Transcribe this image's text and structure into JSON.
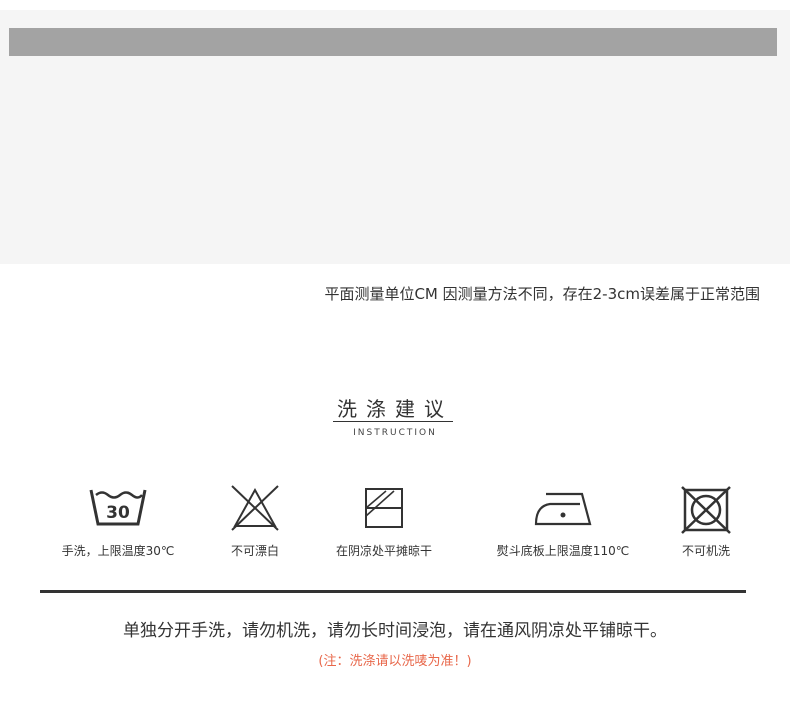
{
  "measurement": {
    "note": "平面测量单位CM  因测量方法不同，存在2-3cm误差属于正常范围"
  },
  "washing": {
    "title": "洗涤建议",
    "subtitle": "INSTRUCTION",
    "symbols": [
      {
        "icon": "hand-wash-30-icon",
        "label": "手洗，上限温度30℃",
        "temp": "30"
      },
      {
        "icon": "no-bleach-icon",
        "label": "不可漂白"
      },
      {
        "icon": "dry-flat-shade-icon",
        "label": "在阴凉处平摊晾干"
      },
      {
        "icon": "iron-low-temp-icon",
        "label": "熨斗底板上限温度110℃"
      },
      {
        "icon": "no-machine-wash-icon",
        "label": "不可机洗"
      }
    ],
    "instruction": "单独分开手洗，请勿机洗，请勿长时间浸泡，请在通风阴凉处平铺晾干。",
    "note": "(注：洗涤请以洗唛为准！)"
  },
  "colors": {
    "text": "#333333",
    "note": "#e8674a",
    "panel": "#f5f5f5",
    "header_bar": "#a3a3a3"
  }
}
